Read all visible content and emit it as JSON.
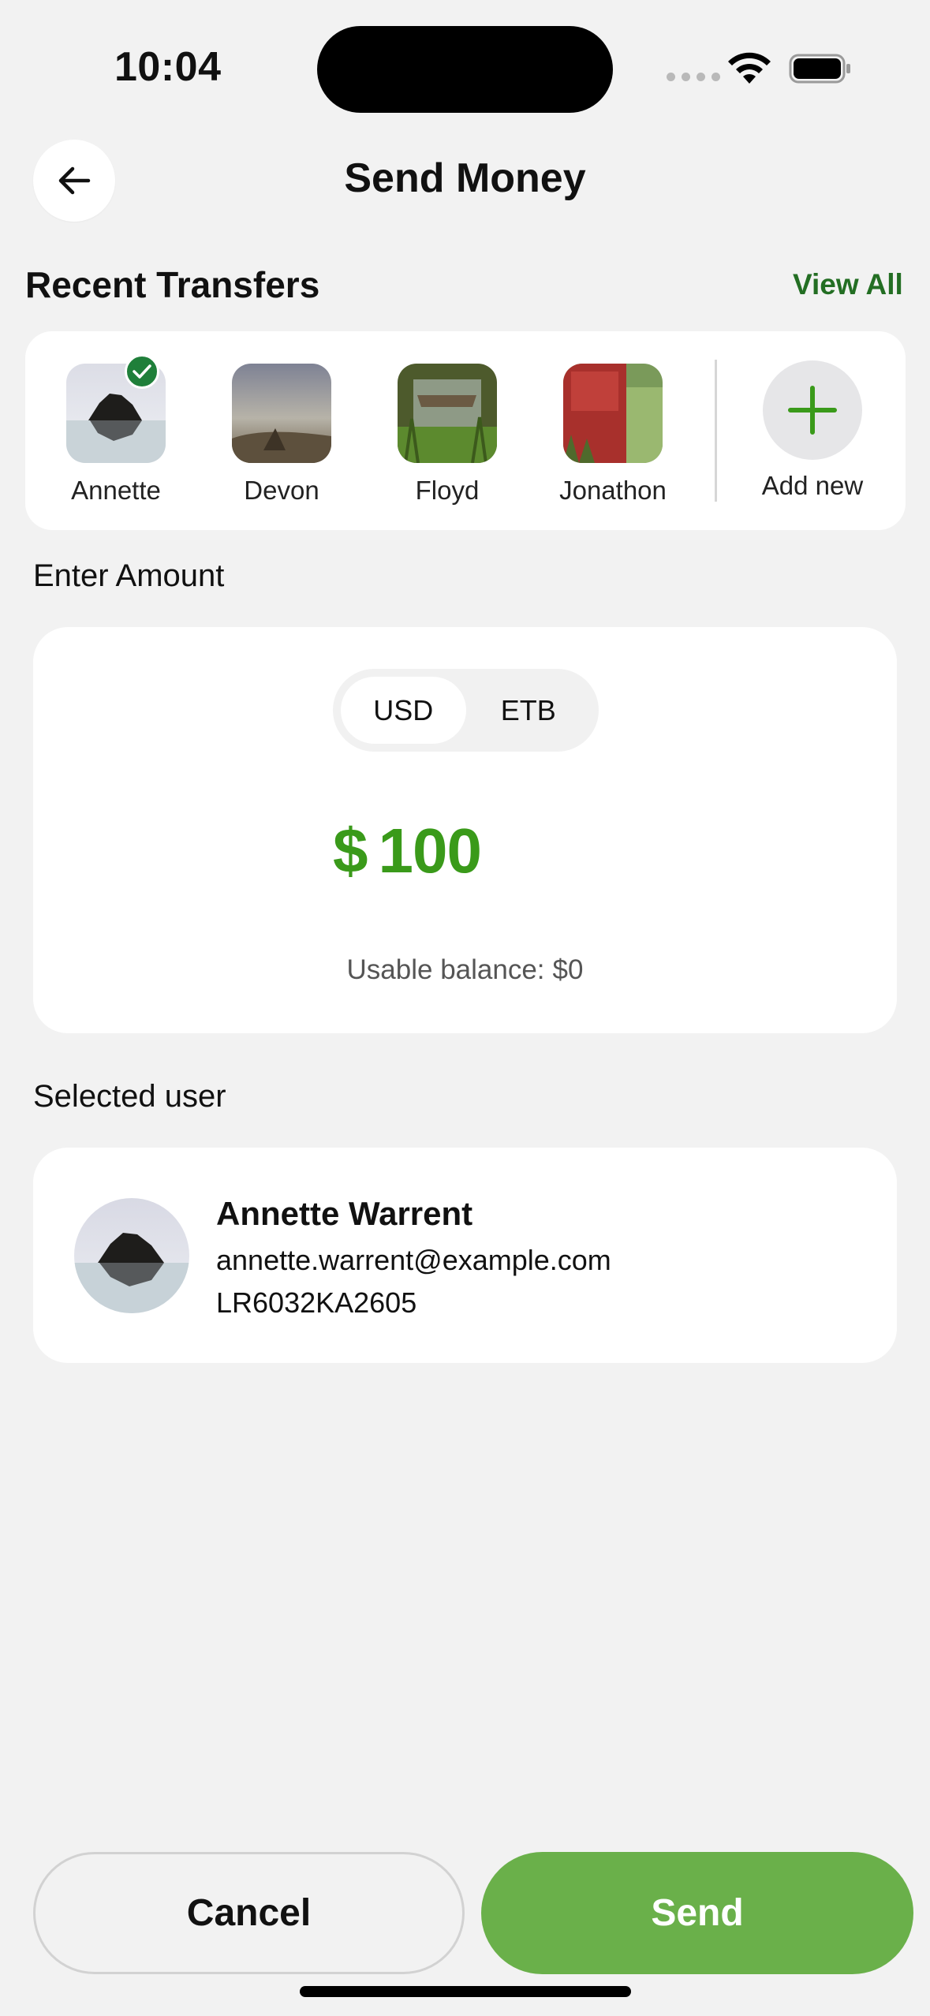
{
  "status_bar": {
    "time": "10:04"
  },
  "header": {
    "title": "Send Money"
  },
  "recent": {
    "title": "Recent Transfers",
    "view_all": "View All",
    "contacts": [
      {
        "name": "Annette",
        "selected": true
      },
      {
        "name": "Devon",
        "selected": false
      },
      {
        "name": "Floyd",
        "selected": false
      },
      {
        "name": "Jonathon",
        "selected": false
      }
    ],
    "add_new": "Add new"
  },
  "amount": {
    "label": "Enter Amount",
    "currencies": [
      "USD",
      "ETB"
    ],
    "selected_currency": "USD",
    "symbol": "$",
    "value": "100",
    "balance_label": "Usable balance:",
    "balance_value": "$0"
  },
  "selected_user": {
    "label": "Selected user",
    "name": "Annette Warrent",
    "email": "annette.warrent@example.com",
    "account": "LR6032KA2605"
  },
  "actions": {
    "cancel": "Cancel",
    "send": "Send"
  },
  "colors": {
    "accent": "#6ab04a",
    "amount": "#3a9a1a",
    "link": "#236e23",
    "check": "#1f7f3a"
  }
}
